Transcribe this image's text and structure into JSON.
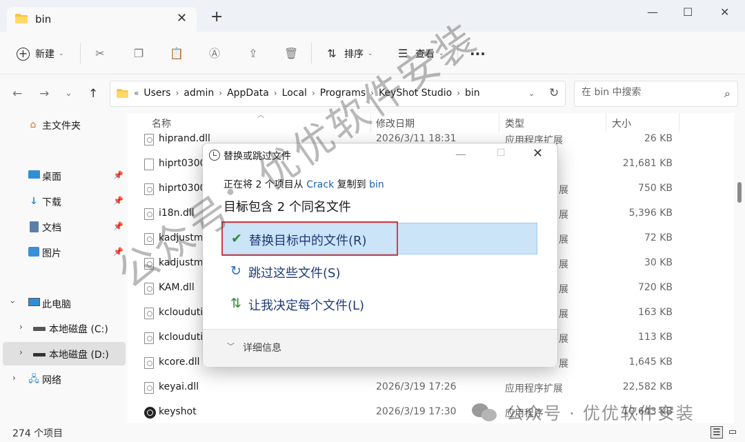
{
  "window": {
    "tab_title": "bin",
    "tab_close": "✕",
    "new_tab": "+",
    "minimize": "—",
    "maximize": "☐",
    "close": "✕"
  },
  "toolbar": {
    "new_label": "新建",
    "sort_label": "排序",
    "view_label": "查看",
    "more": "···",
    "caret": "⌄"
  },
  "nav": {
    "back": "←",
    "forward": "→",
    "recent": "⌄",
    "up": "↑",
    "breadcrumb": [
      "Users",
      "admin",
      "AppData",
      "Local",
      "Programs",
      "KeyShot Studio",
      "bin"
    ],
    "breadcrumb_lead": "«",
    "breadcrumb_sep": "›",
    "search_placeholder": "在 bin 中搜索"
  },
  "sidebar": {
    "items": [
      {
        "label": "主文件夹",
        "icon": "home-icon"
      },
      {
        "label": "桌面",
        "icon": "desktop-icon",
        "pinned": true
      },
      {
        "label": "下载",
        "icon": "download-icon",
        "pinned": true
      },
      {
        "label": "文档",
        "icon": "document-icon",
        "pinned": true
      },
      {
        "label": "图片",
        "icon": "image-icon",
        "pinned": true
      },
      {
        "label": "此电脑",
        "icon": "computer-icon"
      },
      {
        "label": "本地磁盘 (C:)",
        "icon": "drive-icon"
      },
      {
        "label": "本地磁盘 (D:)",
        "icon": "drive-icon",
        "selected": true
      },
      {
        "label": "网络",
        "icon": "network-icon"
      }
    ]
  },
  "columns": {
    "name": "名称",
    "modified": "修改日期",
    "type": "类型",
    "size": "大小"
  },
  "files": [
    {
      "name": "hiprand.dll",
      "date": "2026/3/11 18:31",
      "type": "应用程序扩展",
      "size": "26 KB"
    },
    {
      "name": "hiprt0300",
      "date": "",
      "type": "",
      "size": "21,681 KB"
    },
    {
      "name": "hiprt0300",
      "date": "",
      "type": "展",
      "size": "750 KB"
    },
    {
      "name": "i18n.dll",
      "date": "",
      "type": "展",
      "size": "5,396 KB"
    },
    {
      "name": "kadjustme",
      "date": "",
      "type": "展",
      "size": "72 KB"
    },
    {
      "name": "kadjustme",
      "date": "",
      "type": "展",
      "size": "30 KB"
    },
    {
      "name": "KAM.dll",
      "date": "",
      "type": "展",
      "size": "720 KB"
    },
    {
      "name": "kcloudutil",
      "date": "",
      "type": "展",
      "size": "163 KB"
    },
    {
      "name": "kcloudutil",
      "date": "",
      "type": "展",
      "size": "113 KB"
    },
    {
      "name": "kcore.dll",
      "date": "",
      "type": "展",
      "size": "1,645 KB"
    },
    {
      "name": "keyai.dll",
      "date": "2026/3/19 17:26",
      "type": "应用程序扩展",
      "size": "22,582 KB"
    },
    {
      "name": "keyshot",
      "date": "2026/3/19 17:30",
      "type": "应用程序",
      "size": "10,643 KB"
    }
  ],
  "status": {
    "item_count": "274 个项目"
  },
  "dialog": {
    "title": "替换或跳过文件",
    "subtitle_pre": "正在将 2 个项目从 ",
    "source": "Crack",
    "subtitle_mid": " 复制到 ",
    "destination": "bin",
    "heading": "目标包含 2 个同名文件",
    "option_replace": "替换目标中的文件(R)",
    "option_skip": "跳过这些文件(S)",
    "option_decide": "让我决定每个文件(L)",
    "details": "详细信息"
  },
  "watermark": {
    "diagonal": "公众号：优优软件安装",
    "bottom": "公众号 · 优优软件安装"
  },
  "colors": {
    "accent": "#1a5fb4",
    "selection": "#cce4f7",
    "highlight_box": "#d93a3a",
    "check": "#2e8b3a"
  }
}
